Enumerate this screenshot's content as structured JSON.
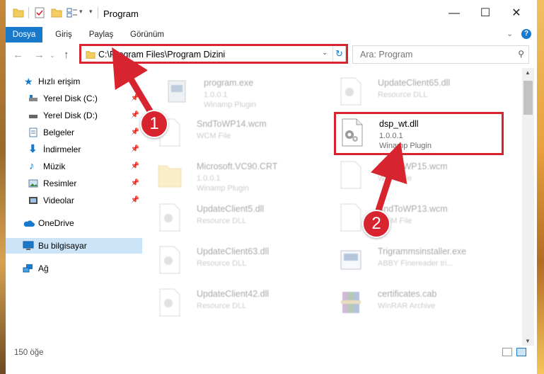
{
  "window": {
    "title": "Program",
    "controls": {
      "minimize": "—",
      "maximize": "☐",
      "close": "✕"
    }
  },
  "ribbon": {
    "tabs": [
      "Dosya",
      "Giriş",
      "Paylaş",
      "Görünüm"
    ]
  },
  "address": {
    "path": "C:\\Program Files\\Program Dizini"
  },
  "search": {
    "placeholder": "Ara: Program"
  },
  "sidebar": {
    "items": [
      {
        "label": "Hızlı erişim",
        "icon": "star-icon"
      },
      {
        "label": "Yerel Disk (C:)",
        "icon": "drive-icon",
        "pinned": true
      },
      {
        "label": "Yerel Disk (D:)",
        "icon": "drive-icon",
        "pinned": true
      },
      {
        "label": "Belgeler",
        "icon": "documents-icon",
        "pinned": true
      },
      {
        "label": "İndirmeler",
        "icon": "download-icon",
        "pinned": true
      },
      {
        "label": "Müzik",
        "icon": "music-icon",
        "pinned": true
      },
      {
        "label": "Resimler",
        "icon": "pictures-icon",
        "pinned": true
      },
      {
        "label": "Videolar",
        "icon": "videos-icon",
        "pinned": true
      },
      {
        "label": "OneDrive",
        "icon": "cloud-icon"
      },
      {
        "label": "Bu bilgisayar",
        "icon": "computer-icon",
        "selected": true
      },
      {
        "label": "Ağ",
        "icon": "network-icon"
      }
    ]
  },
  "files": [
    {
      "name": "program.exe",
      "version": "1.0.0.1",
      "type": "Winamp Plugin"
    },
    {
      "name": "UpdateClient65.dll",
      "version": "",
      "type": "Resource DLL"
    },
    {
      "name": "SndToWP14.wcm",
      "version": "",
      "type": "WCM File"
    },
    {
      "name": "dsp_wt.dll",
      "version": "1.0.0.1",
      "type": "Winamp Plugin"
    },
    {
      "name": "Microsoft.VC90.CRT",
      "version": "1.0.0.1",
      "type": "Winamp Plugin"
    },
    {
      "name": "SndToWP15.wcm",
      "version": "",
      "type": "WCM File"
    },
    {
      "name": "UpdateClient5.dll",
      "version": "",
      "type": "Resource DLL"
    },
    {
      "name": "SndToWP13.wcm",
      "version": "",
      "type": "WCM File"
    },
    {
      "name": "UpdateClient63.dll",
      "version": "",
      "type": "Resource DLL"
    },
    {
      "name": "Trigrammsinstaller.exe",
      "version": "",
      "type": "ABBY Finereader tri..."
    },
    {
      "name": "UpdateClient42.dll",
      "version": "",
      "type": "Resource DLL"
    },
    {
      "name": "certificates.cab",
      "version": "",
      "type": "WinRAR Archive"
    }
  ],
  "status": {
    "count": "150 öğe"
  },
  "markers": [
    "1",
    "2"
  ],
  "colors": {
    "accent": "#1979ca",
    "highlight": "#d8242e",
    "selection": "#cce4f7"
  }
}
